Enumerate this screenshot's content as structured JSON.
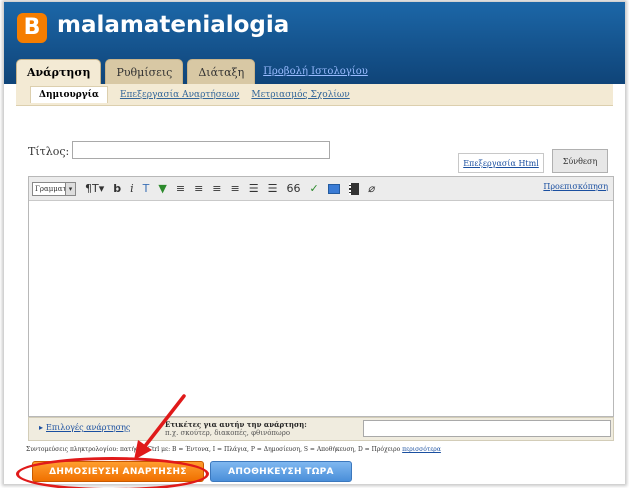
{
  "app": {
    "logo_letter": "B",
    "blog_title": "malamatenialogia",
    "brand_color": "#f57d00"
  },
  "tabs": [
    {
      "label": "Ανάρτηση",
      "active": true
    },
    {
      "label": "Ρυθμίσεις",
      "active": false
    },
    {
      "label": "Διάταξη",
      "active": false
    }
  ],
  "view_blog_link": "Προβολή Ιστολογίου",
  "subtabs": [
    {
      "label": "Δημιουργία",
      "active": true
    },
    {
      "label": "Επεξεργασία Αναρτήσεων",
      "active": false
    },
    {
      "label": "Μετριασμός Σχολίων",
      "active": false
    }
  ],
  "form": {
    "title_label": "Τίτλος:",
    "title_value": ""
  },
  "mode_buttons": {
    "html": "Επεξεργασία Html",
    "compose": "Σύνθεση"
  },
  "toolbar": {
    "font_select": "Γραμματοσ",
    "font_select_icon": "chevron-down-icon",
    "font_size": "¶T▾",
    "bold": "b",
    "italic": "i",
    "text_color": "T",
    "link": "▼",
    "align_left": "≡",
    "align_center": "≡",
    "align_right": "≡",
    "justify": "≡",
    "numbered_list": "☰",
    "bullet_list": "☰",
    "quote": "66",
    "spellcheck": "✓",
    "image": "image-icon",
    "video": "video-icon",
    "clear_format": "⌀",
    "preview": "Προεπισκόπηση"
  },
  "options_row": {
    "post_options": "Επιλογές ανάρτησης",
    "labels_hint_line1": "Ετικέτες για αυτήν την ανάρτηση:",
    "labels_hint_line2": "π.χ. σκούτερ, διακοπές, φθινόπωρο",
    "labels_value": ""
  },
  "shortcuts": {
    "text": "Συντομεύσεις πληκτρολογίου: πατήστε Ctrl με: B = Έντονα, I = Πλάγια, P = Δημοσίευση, S = Αποθήκευση, D = Πρόχειρο",
    "more_link": "περισσότερα"
  },
  "buttons": {
    "publish": "ΔΗΜΟΣΙΕΥΣΗ ΑΝΑΡΤΗΣΗΣ",
    "save": "ΑΠΟΘΗΚΕΥΣΗ ΤΩΡΑ"
  },
  "annotation_color": "#e01a1a"
}
